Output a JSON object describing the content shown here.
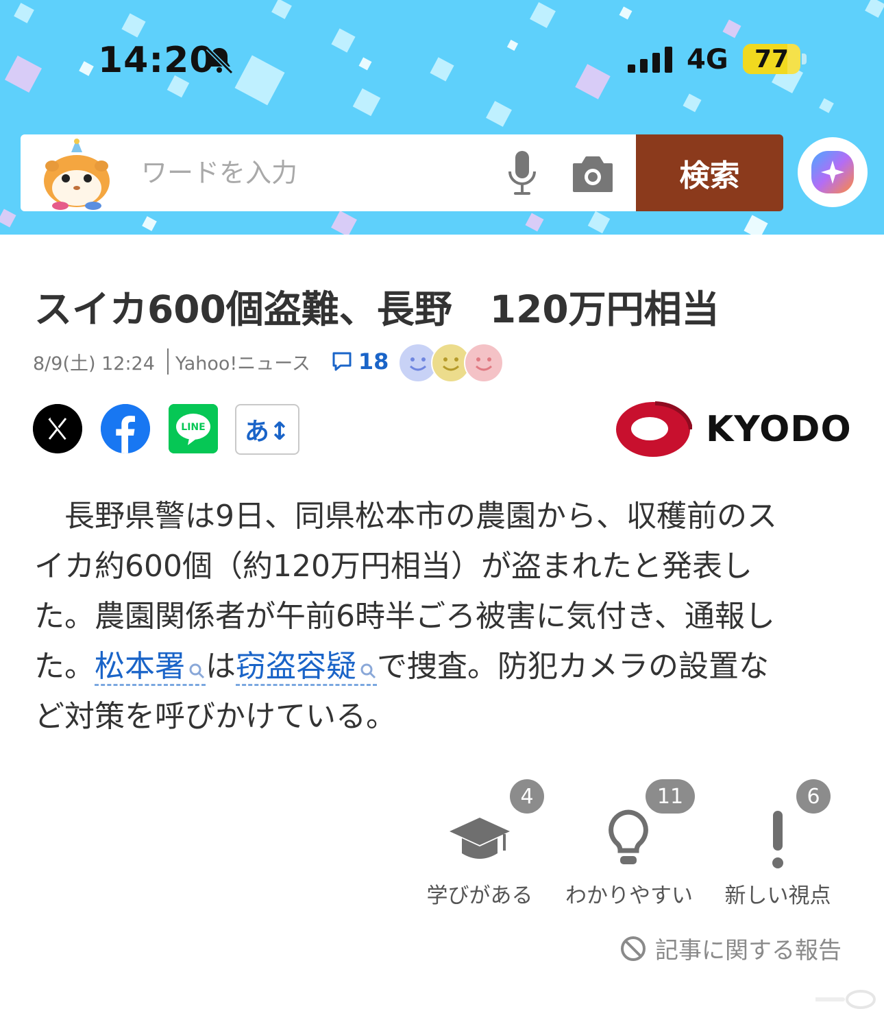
{
  "status_bar": {
    "time": "14:20",
    "network": "4G",
    "battery": "77",
    "battery_level": 0.77
  },
  "search": {
    "placeholder": "ワードを入力",
    "button_label": "検索"
  },
  "article": {
    "title": "スイカ600個盗難、長野　120万円相当",
    "date": "8/9(土) 12:24",
    "source": "Yahoo!ニュース",
    "comment_count": "18",
    "publisher": "KYODO",
    "font_size_label": "あ↕",
    "body": {
      "line1": "　長野県警は9日、同県松本市の農園から、収穫前のス",
      "line2": "イカ約600個（約120万円相当）が盗まれたと発表し",
      "line3": "た。農園関係者が午前6時半ごろ被害に気付き、通報し",
      "line4_start": "た。",
      "link1": "松本署",
      "line4_mid": "は",
      "link2": "窃盗容疑",
      "line4_end": "で捜査。防犯カメラの設置な",
      "line5": "ど対策を呼びかけている。"
    }
  },
  "reactions": [
    {
      "label": "学びがある",
      "count": "4"
    },
    {
      "label": "わかりやすい",
      "count": "11"
    },
    {
      "label": "新しい視点",
      "count": "6"
    }
  ],
  "report_label": "記事に関する報告",
  "colors": {
    "header_bg": "#5ed0fb",
    "search_button": "#8b3a1c",
    "link": "#1a64c8",
    "kyodo_red": "#c8102e"
  }
}
